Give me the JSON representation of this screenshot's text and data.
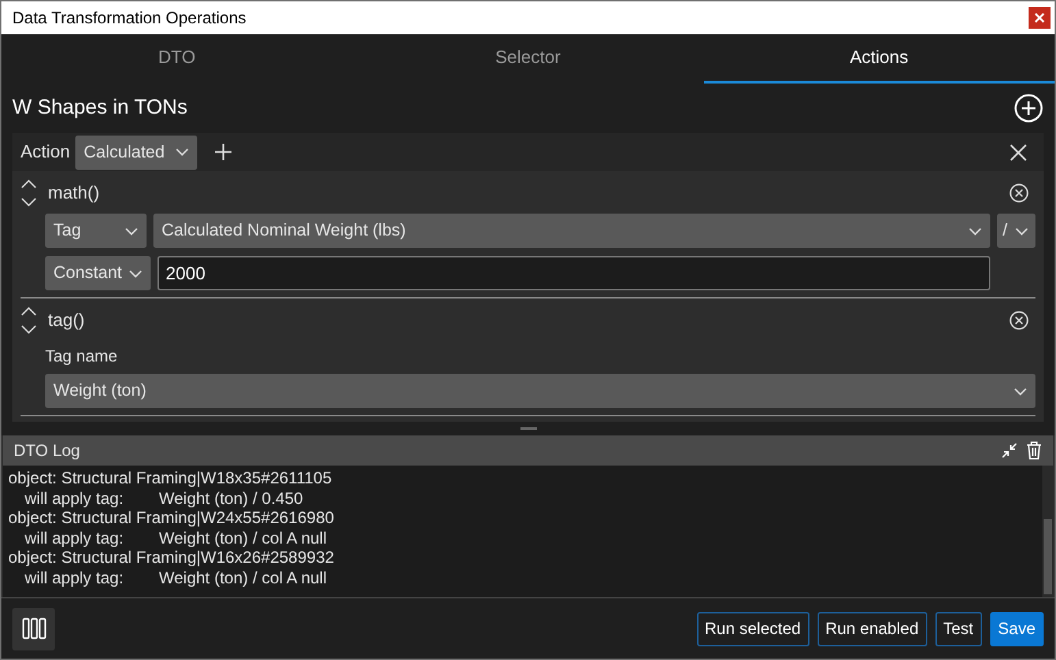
{
  "window": {
    "title": "Data Transformation Operations"
  },
  "tabs": [
    {
      "label": "DTO",
      "selected": false
    },
    {
      "label": "Selector",
      "selected": false
    },
    {
      "label": "Actions",
      "selected": true
    }
  ],
  "heading": "W Shapes in TONs",
  "action": {
    "label": "Action",
    "value": "Calculated"
  },
  "operations": [
    {
      "kind": "math",
      "name": "math()",
      "operand_1": {
        "type": "Tag",
        "value": "Calculated Nominal Weight (lbs)"
      },
      "operator": "/",
      "operand_2": {
        "type": "Constant",
        "value": "2000"
      }
    },
    {
      "kind": "tag",
      "name": "tag()",
      "field_label": "Tag name",
      "value": "Weight (ton)"
    }
  ],
  "log": {
    "title": "DTO Log",
    "lines": [
      {
        "kind": "object",
        "text": "object: Structural Framing|W18x35#2611105"
      },
      {
        "kind": "apply",
        "label": "will apply tag:",
        "value": "Weight (ton) / 0.450"
      },
      {
        "kind": "object",
        "text": "object: Structural Framing|W24x55#2616980"
      },
      {
        "kind": "apply",
        "label": "will apply tag:",
        "value": "Weight (ton) / col A null"
      },
      {
        "kind": "object",
        "text": "object: Structural Framing|W16x26#2589932"
      },
      {
        "kind": "apply",
        "label": "will apply tag:",
        "value": "Weight (ton) / col A null"
      }
    ]
  },
  "buttons": [
    {
      "label": "Run selected",
      "kind": "outline"
    },
    {
      "label": "Run enabled",
      "kind": "outline"
    },
    {
      "label": "Test",
      "kind": "outline"
    },
    {
      "label": "Save",
      "kind": "primary"
    }
  ]
}
